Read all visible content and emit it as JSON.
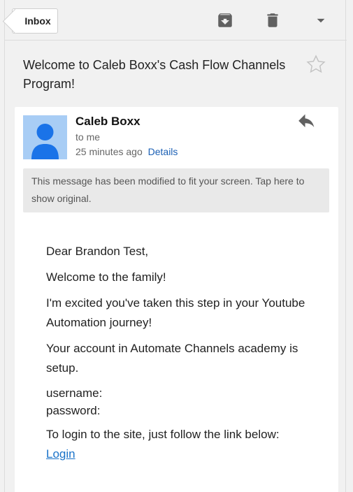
{
  "toolbar": {
    "back_label": "Inbox",
    "icons": [
      "archive-icon",
      "delete-icon",
      "dropdown-icon"
    ]
  },
  "message": {
    "subject": "Welcome to Caleb Boxx's Cash Flow Channels Program!",
    "sender": "Caleb Boxx",
    "recipient": "to me",
    "time": "25 minutes ago",
    "details_label": "Details",
    "notice": "This message has been modified to fit your screen. Tap here to show original."
  },
  "body": {
    "greeting": "Dear Brandon Test,",
    "welcome": "Welcome to the family!",
    "excited": "I'm excited you've taken this step in your Youtube Automation journey!",
    "account": "Your account in Automate Channels academy is setup.",
    "username_label": "username:",
    "password_label": "password:",
    "login_instructions": "To login to the site, just follow the link below:",
    "login_link": "Login"
  },
  "colors": {
    "background": "#f1f1f1",
    "avatar_bg": "#a8cdf5",
    "avatar_figure": "#1a73e8",
    "link": "#1a73c9"
  }
}
